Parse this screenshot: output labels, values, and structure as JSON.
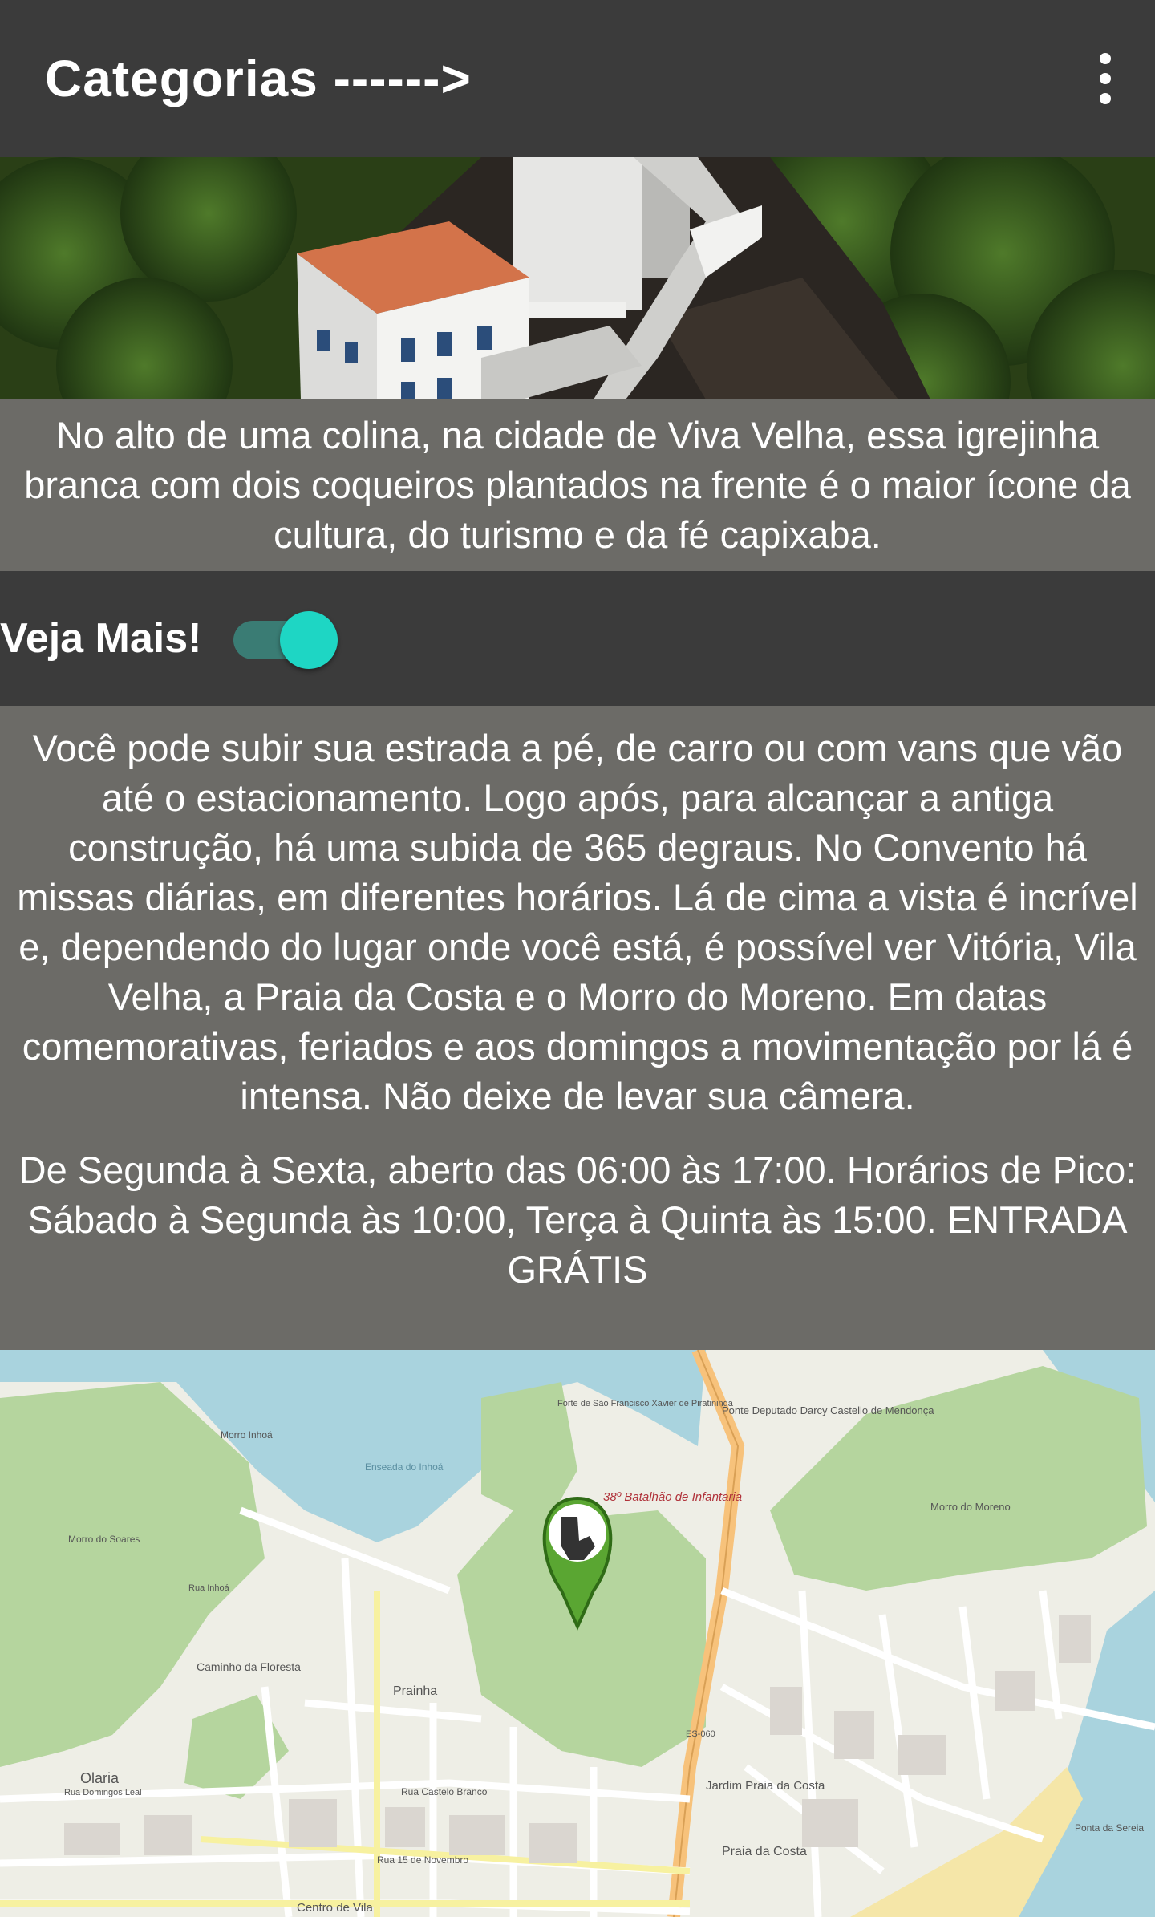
{
  "appbar": {
    "title": "Categorias ------>",
    "menu_icon": "more-vert-icon"
  },
  "hero": {
    "description": "No alto de uma colina, na cidade de Viva Velha, essa igrejinha branca com dois coqueiros plantados na frente é o maior ícone da cultura, do turismo e da fé capixaba."
  },
  "toggle": {
    "label": "Veja Mais!",
    "state": "on",
    "accent": "#1ed6c4"
  },
  "details": {
    "body": "Você pode subir sua estrada a pé, de carro ou com vans que vão até o estacionamento. Logo após, para alcançar a antiga construção, há uma subida de 365 degraus. No Convento há missas diárias, em diferentes horários. Lá de cima a vista é incrível e, dependendo do lugar onde você está, é possível ver Vitória, Vila Velha, a Praia da Costa e o Morro do Moreno. Em datas comemorativas, feriados e aos domingos a movimentação por lá é intensa. Não deixe de levar sua câmera.",
    "hours": "De Segunda à Sexta, aberto das 06:00 às 17:00. Horários de Pico: Sábado à Segunda às 10:00, Terça à Quinta às 15:00. ENTRADA GRÁTIS"
  },
  "map": {
    "labels": {
      "ponte": "Ponte Deputado Darcy Castello de Mendonça",
      "batalhao": "38º Batalhão de Infantaria",
      "olaria": "Olaria",
      "prainha": "Prainha",
      "caminho": "Caminho da Floresta",
      "jardim": "Jardim Praia da Costa",
      "praia_costa": "Praia da Costa",
      "centro": "Centro de Vila",
      "ponta_sereia": "Ponta da Sereia",
      "rua_castelo": "Rua Castelo Branco",
      "rua_novembro": "Rua 15 de Novembro",
      "es060": "ES-060",
      "morro_moreno": "Morro do Moreno",
      "forte": "Forte de São Francisco Xavier de Piratininga",
      "ilhota": "Morro Inhoá",
      "soares": "Morro do Soares",
      "enseada": "Enseada do Inhoá",
      "rua_inhoa": "Rua Inhoá",
      "rua_domingos": "Rua Domingos Leal"
    },
    "pin_icon": "map-pin-hand-icon"
  }
}
